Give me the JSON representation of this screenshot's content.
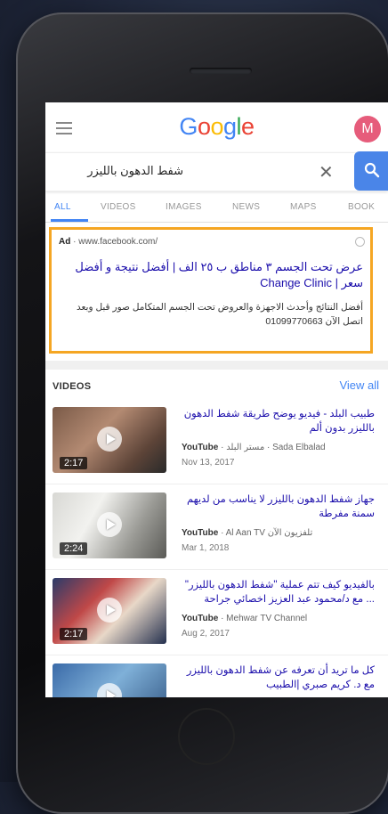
{
  "search": {
    "query": "شفط الدهون بالليزر",
    "avatar_letter": "M"
  },
  "logo": [
    "G",
    "o",
    "o",
    "g",
    "l",
    "e"
  ],
  "tabs": [
    "ALL",
    "VIDEOS",
    "IMAGES",
    "NEWS",
    "MAPS",
    "BOOK"
  ],
  "ad": {
    "badge": "Ad",
    "url": "· www.facebook.com/",
    "title": "عرض تحت الجسم ٣ مناطق ب ٢٥ الف | أفضل نتيجة و أفضل سعر | Change Clinic",
    "description": "أفضل النتائج وأحدث الاجهزة والعروض تحت الجسم المتكامل صور قبل وبعد اتصل الآن 01099770663"
  },
  "videos": {
    "heading": "VIDEOS",
    "view_all": "View all",
    "items": [
      {
        "title": "طبيب البلد - فيديو يوضح طريقة شفط الدهون بالليزر بدون ألم",
        "source": "YouTube",
        "channel": "· مستر البلد · Sada Elbalad",
        "date": "Nov 13, 2017",
        "duration": "2:17"
      },
      {
        "title": "جهاز شفط الدهون بالليزر لا يناسب من لديهم سمنة مفرطة",
        "source": "YouTube",
        "channel": "· Al Aan TV تلفزيون الآن",
        "date": "Mar 1, 2018",
        "duration": "2:24"
      },
      {
        "title": "بالفيديو كيف تتم عملية \"شفط الدهون بالليزر\" ... مع د/محمود عبد العزيز اخصائي جراحة",
        "source": "YouTube",
        "channel": "· Mehwar TV Channel",
        "date": "Aug 2, 2017",
        "duration": "2:17"
      },
      {
        "title": "كل ما تريد أن تعرفه عن شفط الدهون بالليزر مع د. كريم صبري |الطبيب",
        "source": "",
        "channel": "",
        "date": "",
        "duration": ""
      }
    ]
  },
  "colors": {
    "google_blue": "#4285f4",
    "ad_border": "#f5a623",
    "link": "#1a0dab",
    "avatar": "#e65c7b"
  }
}
